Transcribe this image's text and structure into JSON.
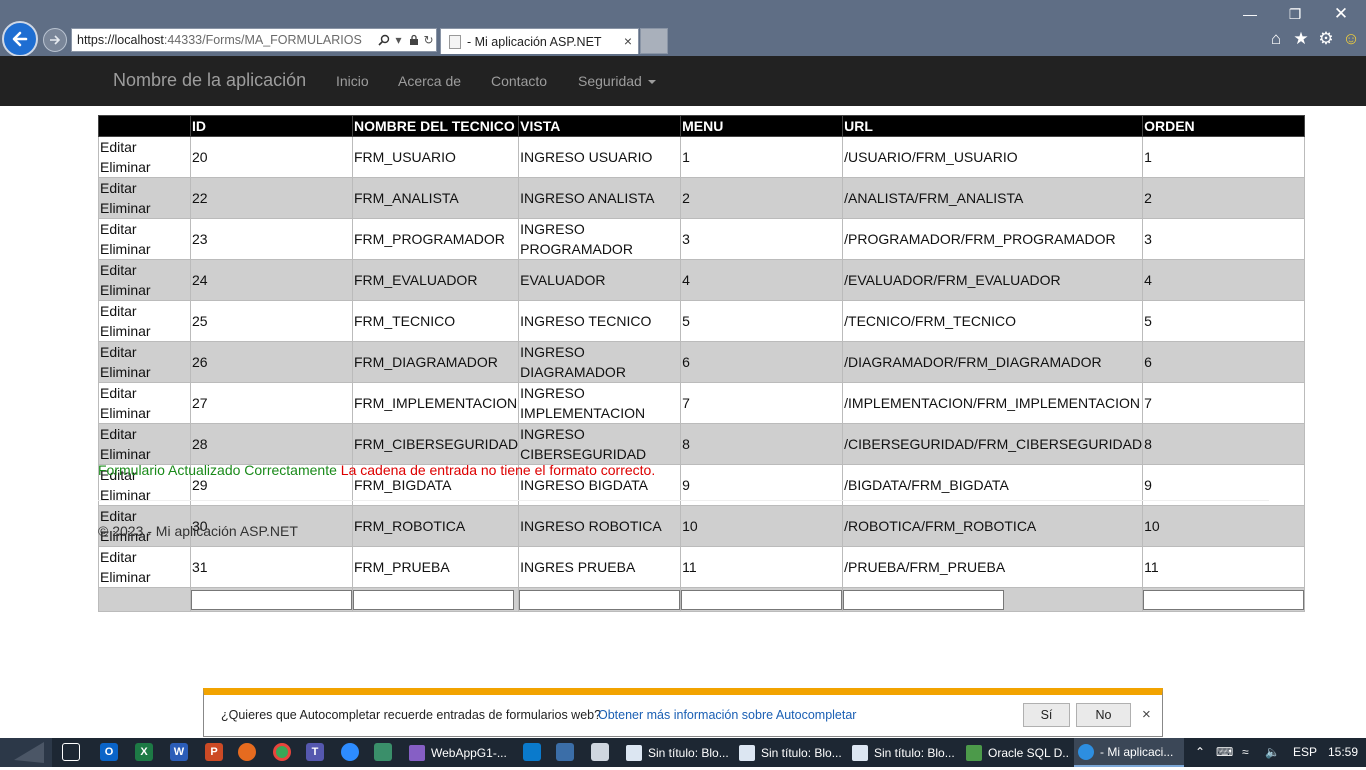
{
  "browser": {
    "address": {
      "prefix": "https://localhost",
      "rest": ":44333/Forms/MA_FORMULARIOS"
    },
    "tab_title": "- Mi aplicación ASP.NET",
    "tab_close": "×"
  },
  "navbar": {
    "brand": "Nombre de la aplicación",
    "links": [
      "Inicio",
      "Acerca de",
      "Contacto",
      "Seguridad"
    ]
  },
  "grid": {
    "columns": [
      "ID",
      "NOMBRE DEL TECNICO",
      "VISTA",
      "MENU",
      "URL",
      "ORDEN"
    ],
    "command_edit": "Editar",
    "command_delete": "Eliminar",
    "rows": [
      {
        "id": "20",
        "nombre": "FRM_USUARIO",
        "vista": "INGRESO USUARIO",
        "menu": "1",
        "url": "/USUARIO/FRM_USUARIO",
        "orden": "1"
      },
      {
        "id": "22",
        "nombre": "FRM_ANALISTA",
        "vista": "INGRESO ANALISTA",
        "menu": "2",
        "url": "/ANALISTA/FRM_ANALISTA",
        "orden": "2"
      },
      {
        "id": "23",
        "nombre": "FRM_PROGRAMADOR",
        "vista": "INGRESO PROGRAMADOR",
        "menu": "3",
        "url": "/PROGRAMADOR/FRM_PROGRAMADOR",
        "orden": "3"
      },
      {
        "id": "24",
        "nombre": "FRM_EVALUADOR",
        "vista": "EVALUADOR",
        "menu": "4",
        "url": "/EVALUADOR/FRM_EVALUADOR",
        "orden": "4"
      },
      {
        "id": "25",
        "nombre": "FRM_TECNICO",
        "vista": "INGRESO TECNICO",
        "menu": "5",
        "url": "/TECNICO/FRM_TECNICO",
        "orden": "5"
      },
      {
        "id": "26",
        "nombre": "FRM_DIAGRAMADOR",
        "vista": "INGRESO DIAGRAMADOR",
        "menu": "6",
        "url": "/DIAGRAMADOR/FRM_DIAGRAMADOR",
        "orden": "6"
      },
      {
        "id": "27",
        "nombre": "FRM_IMPLEMENTACION",
        "vista": "INGRESO IMPLEMENTACION",
        "menu": "7",
        "url": "/IMPLEMENTACION/FRM_IMPLEMENTACION",
        "orden": "7"
      },
      {
        "id": "28",
        "nombre": "FRM_CIBERSEGURIDAD",
        "vista": "INGRESO CIBERSEGURIDAD",
        "menu": "8",
        "url": "/CIBERSEGURIDAD/FRM_CIBERSEGURIDAD",
        "orden": "8"
      },
      {
        "id": "29",
        "nombre": "FRM_BIGDATA",
        "vista": "INGRESO BIGDATA",
        "menu": "9",
        "url": "/BIGDATA/FRM_BIGDATA",
        "orden": "9"
      },
      {
        "id": "30",
        "nombre": "FRM_ROBOTICA",
        "vista": "INGRESO ROBOTICA",
        "menu": "10",
        "url": "/ROBOTICA/FRM_ROBOTICA",
        "orden": "10"
      },
      {
        "id": "31",
        "nombre": "FRM_PRUEBA",
        "vista": "INGRES PRUEBA",
        "menu": "11",
        "url": "/PRUEBA/FRM_PRUEBA",
        "orden": "11"
      }
    ]
  },
  "messages": {
    "success": "Formulario Actualizado Correctamente",
    "error": "La cadena de entrada no tiene el formato correcto."
  },
  "footer": {
    "copyright": "© 2023 - Mi aplicación ASP.NET"
  },
  "notification": {
    "text": "¿Quieres que Autocompletar recuerde entradas de formularios web?",
    "link": "Obtener más información sobre Autocompletar",
    "yes": "Sí",
    "no": "No",
    "close": "×"
  },
  "taskbar": {
    "buttons": [
      "WebAppG1-...",
      "Sin título: Blo...",
      "Sin título: Blo...",
      "Sin título: Blo...",
      "Oracle SQL D...",
      "- Mi aplicaci..."
    ],
    "language": "ESP",
    "time": "15:59"
  },
  "colors": {
    "navbar_bg": "#222222",
    "header_bg": "#000000",
    "alt_row": "#cfcfcf",
    "success": "#1a8a1a",
    "error": "#dd0000",
    "notify_accent": "#f2a300"
  }
}
